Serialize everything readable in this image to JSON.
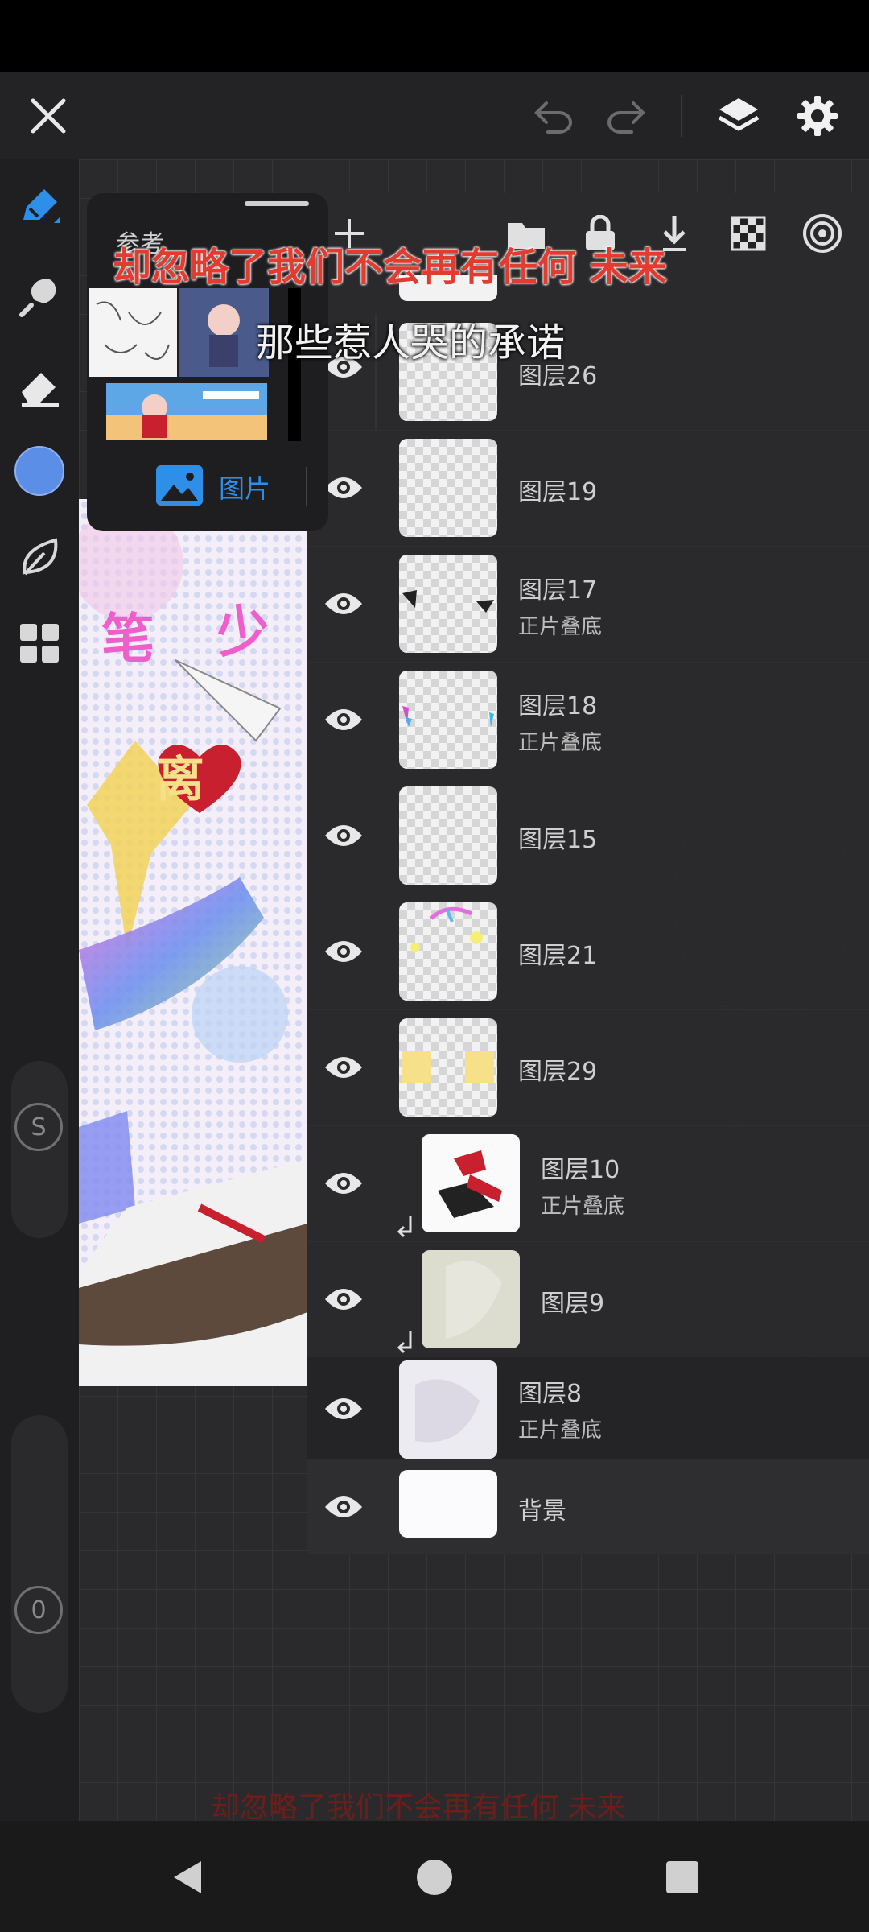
{
  "toolbar": {
    "close_icon": "close-icon",
    "undo_icon": "undo-icon",
    "redo_icon": "redo-icon",
    "layers_icon": "layers-icon",
    "settings_icon": "gear-icon"
  },
  "left_tools": [
    "pen-icon",
    "smudge-icon",
    "eraser-icon",
    "color-swatch",
    "leaf-icon",
    "grid-icon"
  ],
  "left_tools_extra": {
    "s_label": "S",
    "zero_label": "0",
    "current_color": "#5b8ee6"
  },
  "reference_panel": {
    "title": "参考",
    "tab_label": "图片"
  },
  "layers_toolbar": [
    "add-icon",
    "folder-icon",
    "lock-icon",
    "merge-down-icon",
    "checker-icon",
    "target-icon"
  ],
  "layers": [
    {
      "name": "图层26",
      "blend": ""
    },
    {
      "name": "图层19",
      "blend": ""
    },
    {
      "name": "图层17",
      "blend": "正片叠底"
    },
    {
      "name": "图层18",
      "blend": "正片叠底"
    },
    {
      "name": "图层15",
      "blend": ""
    },
    {
      "name": "图层21",
      "blend": ""
    },
    {
      "name": "图层29",
      "blend": ""
    },
    {
      "name": "图层10",
      "blend": "正片叠底"
    },
    {
      "name": "图层9",
      "blend": ""
    },
    {
      "name": "图层8",
      "blend": "正片叠底"
    },
    {
      "name": "背景",
      "blend": ""
    }
  ],
  "artwork_text": {
    "char1": "笔",
    "char2": "少",
    "char3": "离"
  },
  "subtitles": {
    "line1": "却忽略了我们不会再有任何 未来",
    "line2": "那些惹人哭的承诺",
    "bottom": "却忽略了我们不会再有任何 未来"
  },
  "colors": {
    "accent_blue": "#2e8fe8",
    "subtitle_red": "#e23b2f"
  }
}
